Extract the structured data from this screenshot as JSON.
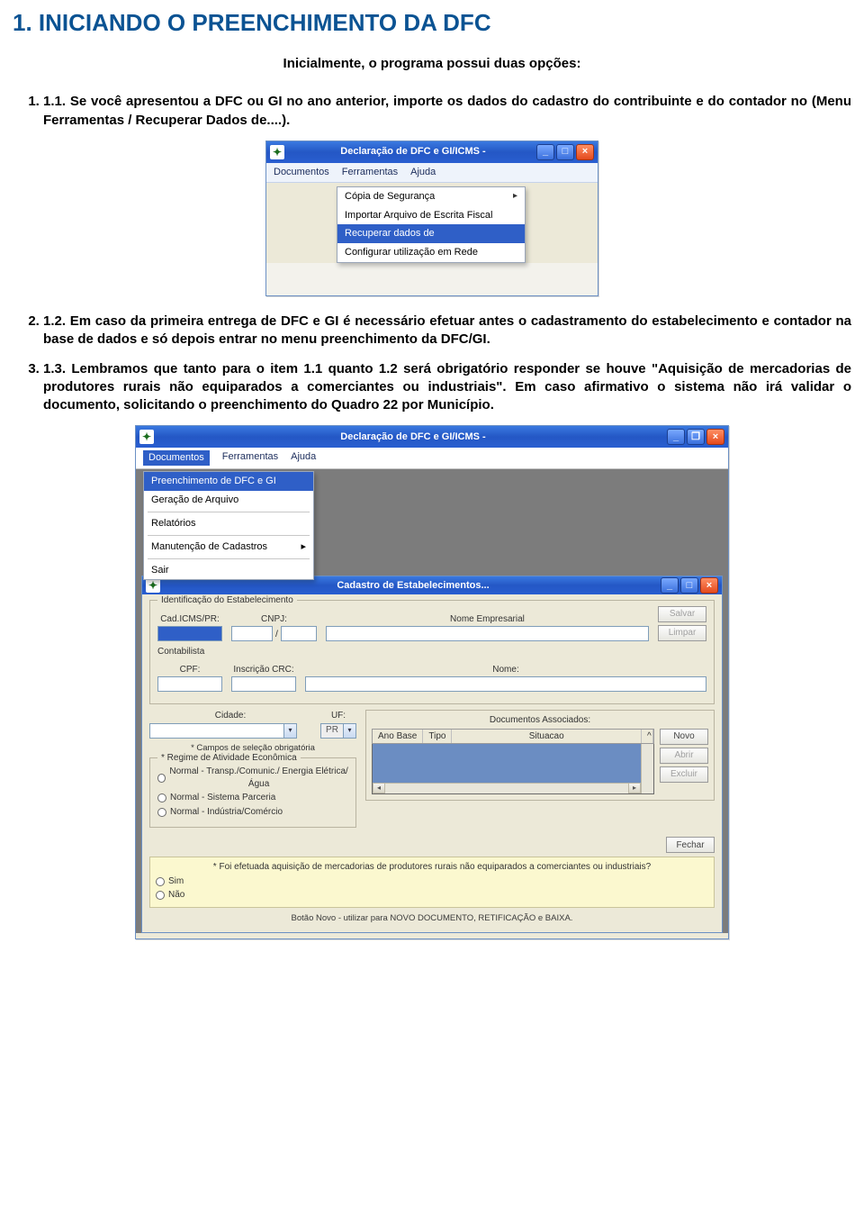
{
  "title": "1. INICIANDO O PREENCHIMENTO DA DFC",
  "intro": "Inicialmente, o programa possui duas opções:",
  "items": {
    "i1": "Se você apresentou a DFC ou GI no ano anterior, importe os dados do cadastro do contribuinte e do contador no (Menu Ferramentas / Recuperar Dados de....).",
    "i2": "Em caso da primeira entrega de DFC e GI é necessário efetuar antes o cadastramento do estabelecimento e contador na base de dados e só depois entrar no menu preenchimento da DFC/GI.",
    "i3": "Lembramos que tanto para o item 1.1 quanto 1.2 será obrigatório responder se houve \"Aquisição de mercadorias de produtores rurais não equiparados a comerciantes ou industriais\". Em caso afirmativo o sistema não irá validar o documento, solicitando o preenchimento do Quadro 22 por Município."
  },
  "win1": {
    "caption": "Declaração de DFC e GI/ICMS -",
    "menus": {
      "m1": "Documentos",
      "m2": "Ferramentas",
      "m3": "Ajuda"
    },
    "dropdown": {
      "d1": "Cópia de Segurança",
      "d2": "Importar Arquivo de Escrita Fiscal",
      "d3": "Recuperar dados de",
      "d4": "Configurar utilização em Rede"
    }
  },
  "win2": {
    "caption": "Declaração de DFC e GI/ICMS -",
    "menus": {
      "m1": "Documentos",
      "m2": "Ferramentas",
      "m3": "Ajuda"
    },
    "dropdown": {
      "d1": "Preenchimento de DFC e GI",
      "d2": "Geração de Arquivo",
      "d3": "Relatórios",
      "d4": "Manutenção de Cadastros",
      "d5": "Sair"
    },
    "inner": {
      "caption": "Cadastro de Estabelecimentos...",
      "grp1": "Identificação do Estabelecimento",
      "labels": {
        "cad": "Cad.ICMS/PR:",
        "cnpj": "CNPJ:",
        "nome_emp": "Nome Empresarial",
        "contab": "Contabilista",
        "cpf": "CPF:",
        "crc": "Inscrição CRC:",
        "nome": "Nome:",
        "cidade": "Cidade:",
        "uf": "UF:",
        "uf_val": "PR",
        "docs": "Documentos Associados:",
        "col1": "Ano Base",
        "col2": "Tipo",
        "col3": "Situacao"
      },
      "buttons": {
        "salvar": "Salvar",
        "limpar": "Limpar",
        "novo": "Novo",
        "abrir": "Abrir",
        "excluir": "Excluir",
        "fechar": "Fechar"
      },
      "note_campos": "* Campos de seleção obrigatória",
      "grp_regime": "* Regime de Atividade Econômica",
      "regimes": {
        "r1": "Normal - Transp./Comunic./ Energia Elétrica/Água",
        "r2": "Normal - Sistema Parceria",
        "r3": "Normal - Indústria/Comércio"
      },
      "question": "* Foi efetuada aquisição de mercadorias de produtores rurais não equiparados a comerciantes ou industriais?",
      "sim": "Sim",
      "nao": "Não",
      "bottom": "Botão Novo - utilizar para NOVO DOCUMENTO, RETIFICAÇÃO e BAIXA."
    }
  }
}
